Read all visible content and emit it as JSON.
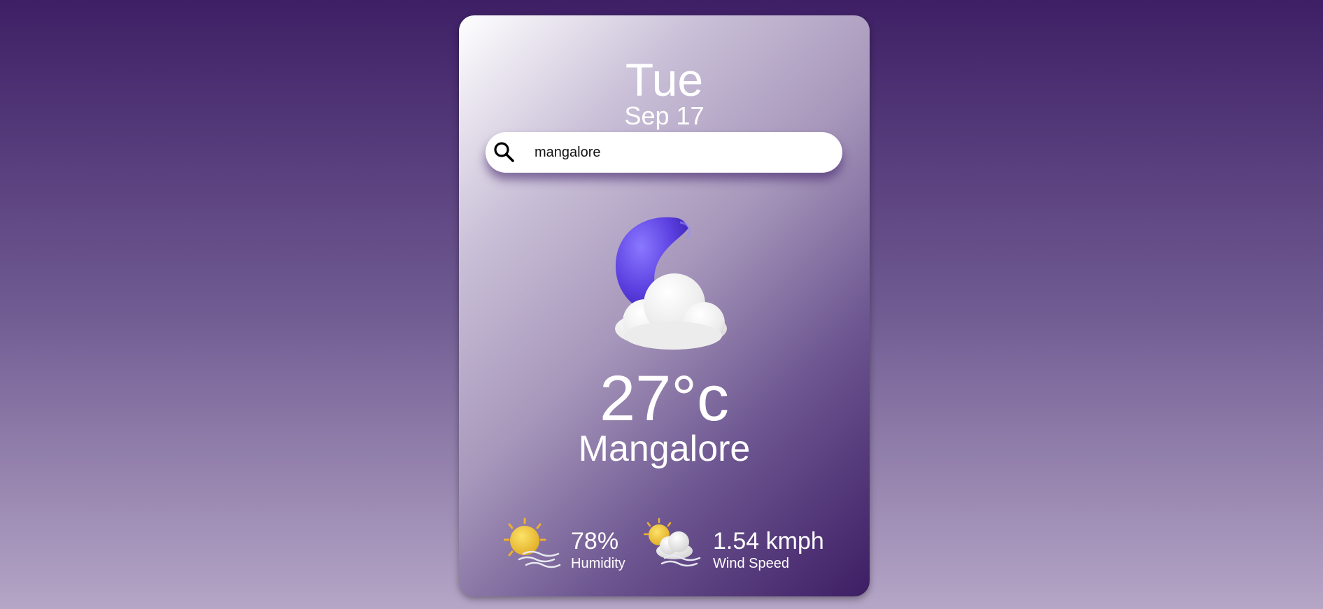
{
  "header": {
    "day": "Tue",
    "date": "Sep 17"
  },
  "search": {
    "value": "mangalore",
    "icon": "search-icon"
  },
  "weather": {
    "icon": "moon-cloud-icon",
    "temperature": "27°c",
    "city": "Mangalore"
  },
  "details": {
    "humidity": {
      "icon": "sun-haze-icon",
      "value": "78%",
      "label": "Humidity"
    },
    "wind": {
      "icon": "sun-cloud-wind-icon",
      "value": "1.54 kmph",
      "label": "Wind Speed"
    }
  },
  "colors": {
    "background_top": "#3e1f66",
    "background_bottom": "#b5a5c6",
    "card_dark": "#3d1d64",
    "moon": "#5a3ee0",
    "sun": "#f0c53a"
  }
}
